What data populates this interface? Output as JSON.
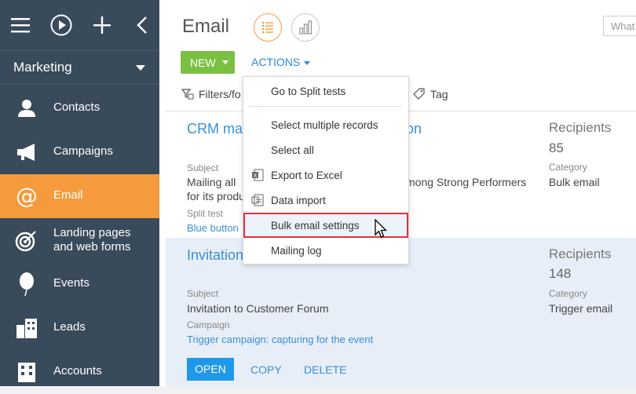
{
  "sidebar": {
    "workspace": "Marketing",
    "items": [
      {
        "label": "Contacts",
        "icon": "person-icon"
      },
      {
        "label": "Campaigns",
        "icon": "megaphone-icon"
      },
      {
        "label": "Email",
        "icon": "at-sign-icon"
      },
      {
        "label": "Landing pages",
        "label2": "and web forms",
        "icon": "target-icon"
      },
      {
        "label": "Events",
        "icon": "balloon-icon"
      },
      {
        "label": "Leads",
        "icon": "buildings-icon"
      },
      {
        "label": "Accounts",
        "icon": "building-icon"
      }
    ],
    "active_index": 2
  },
  "header": {
    "title": "Email",
    "search_placeholder": "What",
    "new_label": "NEW",
    "actions_label": "ACTIONS",
    "filters_label": "Filters/fo",
    "tag_label": "Tag"
  },
  "actions_menu": {
    "items": [
      {
        "label": "Go to Split tests"
      },
      {
        "label": "Select multiple records"
      },
      {
        "label": "Select all"
      },
      {
        "label": "Export to Excel",
        "icon": "excel-icon"
      },
      {
        "label": "Data import",
        "icon": "import-icon"
      },
      {
        "label": "Bulk email settings",
        "highlighted": true
      },
      {
        "label": "Mailing log"
      }
    ]
  },
  "records": [
    {
      "title_left": "CRM ma",
      "title_right": "on",
      "subject_label": "Subject",
      "subject_line1_left": "Mailing  all",
      "subject_line1_right": "mong Strong Performers",
      "subject_line2": "for its produ",
      "split_label": "Split test",
      "split_value": "Blue button",
      "recipients_label": "Recipients",
      "recipients": "85",
      "category_label": "Category",
      "category": "Bulk email"
    },
    {
      "title": "Invitation",
      "subject_label": "Subject",
      "subject": "Invitation to Customer Forum",
      "campaign_label": "Campaign",
      "campaign": "Trigger campaign: capturing for the event",
      "recipients_label": "Recipients",
      "recipients": "148",
      "category_label": "Category",
      "category": "Trigger email",
      "buttons": {
        "open": "OPEN",
        "copy": "COPY",
        "delete": "DELETE"
      }
    }
  ],
  "colors": {
    "sidebar": "#394a5b",
    "active": "#f69a3e",
    "new_button": "#7ac142",
    "link": "#3a8fd8",
    "highlight": "#e0333b"
  }
}
